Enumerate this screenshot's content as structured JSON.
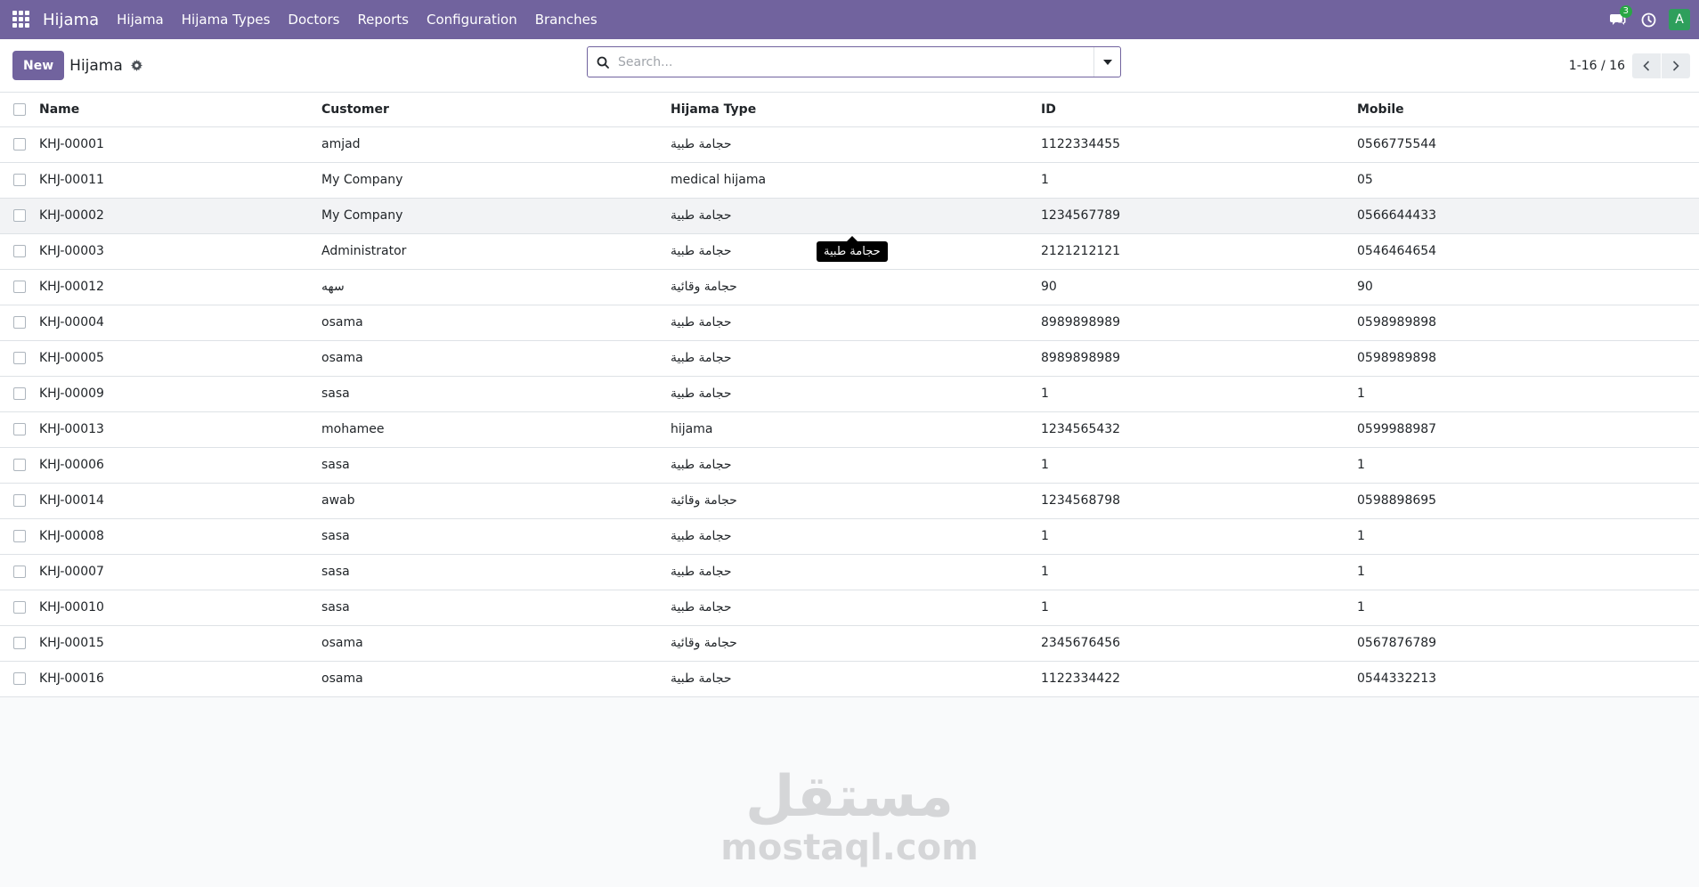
{
  "navbar": {
    "brand": "Hijama",
    "menu": [
      "Hijama",
      "Hijama Types",
      "Doctors",
      "Reports",
      "Configuration",
      "Branches"
    ],
    "chat_count": "3",
    "avatar_initial": "A"
  },
  "control_panel": {
    "new_label": "New",
    "title": "Hijama",
    "search_placeholder": "Search...",
    "pager": "1-16 / 16"
  },
  "table": {
    "headers": [
      "Name",
      "Customer",
      "Hijama Type",
      "ID",
      "Mobile"
    ],
    "rows": [
      [
        "KHJ-00001",
        "amjad",
        "حجامة طبية",
        "1122334455",
        "0566775544"
      ],
      [
        "KHJ-00011",
        "My Company",
        "medical hijama",
        "1",
        "05"
      ],
      [
        "KHJ-00002",
        "My Company",
        "حجامة طبية",
        "1234567789",
        "0566644433"
      ],
      [
        "KHJ-00003",
        "Administrator",
        "حجامة طبية",
        "2121212121",
        "0546464654"
      ],
      [
        "KHJ-00012",
        "سهه",
        "حجامة وقائية",
        "90",
        "90"
      ],
      [
        "KHJ-00004",
        "osama",
        "حجامة طبية",
        "8989898989",
        "0598989898"
      ],
      [
        "KHJ-00005",
        "osama",
        "حجامة طبية",
        "8989898989",
        "0598989898"
      ],
      [
        "KHJ-00009",
        "sasa",
        "حجامة طبية",
        "1",
        "1"
      ],
      [
        "KHJ-00013",
        "mohamee",
        "hijama",
        "1234565432",
        "0599988987"
      ],
      [
        "KHJ-00006",
        "sasa",
        "حجامة طبية",
        "1",
        "1"
      ],
      [
        "KHJ-00014",
        "awab",
        "حجامة وقائية",
        "1234568798",
        "0598898695"
      ],
      [
        "KHJ-00008",
        "sasa",
        "حجامة طبية",
        "1",
        "1"
      ],
      [
        "KHJ-00007",
        "sasa",
        "حجامة طبية",
        "1",
        "1"
      ],
      [
        "KHJ-00010",
        "sasa",
        "حجامة طبية",
        "1",
        "1"
      ],
      [
        "KHJ-00015",
        "osama",
        "حجامة وقائية",
        "2345676456",
        "0567876789"
      ],
      [
        "KHJ-00016",
        "osama",
        "حجامة طبية",
        "1122334422",
        "0544332213"
      ]
    ]
  },
  "tooltip": "حجامة طبية",
  "watermark": {
    "arabic": "مستقل",
    "latin": "mostaql.com"
  },
  "colors": {
    "navbar": "#71639e",
    "primary": "#71639e"
  }
}
